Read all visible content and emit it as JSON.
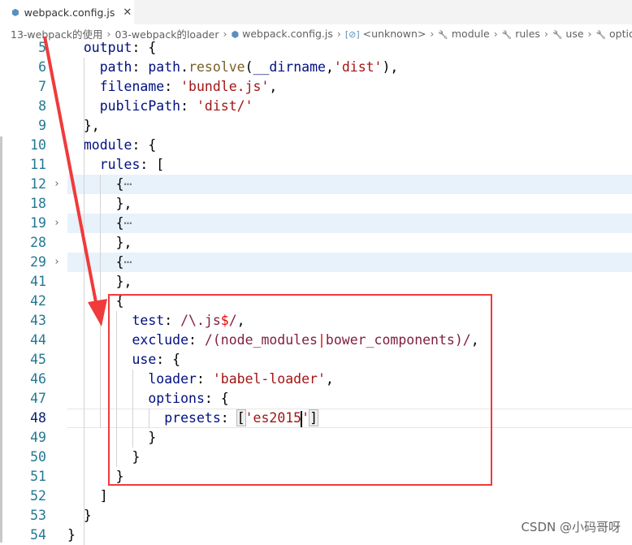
{
  "tab": {
    "title": "webpack.config.js",
    "icon": "webpack-icon",
    "close": "✕"
  },
  "breadcrumbs": [
    "13-webpack的使用",
    "03-webpack的loader",
    "webpack.config.js",
    "<unknown>",
    "module",
    "rules",
    "use",
    "options"
  ],
  "editor": {
    "current_line": 48,
    "lines": [
      {
        "n": 5,
        "t": [
          [
            "  ",
            ""
          ],
          [
            "output",
            "k"
          ],
          [
            ": {",
            "p"
          ]
        ]
      },
      {
        "n": 6,
        "t": [
          [
            "    ",
            ""
          ],
          [
            "path",
            "k"
          ],
          [
            ": ",
            "p"
          ],
          [
            "path",
            "k"
          ],
          [
            ".",
            "p"
          ],
          [
            "resolve",
            "f"
          ],
          [
            "(",
            "p"
          ],
          [
            "__dirname",
            "k"
          ],
          [
            ",",
            "p"
          ],
          [
            "'dist'",
            "s"
          ],
          [
            "),",
            "p"
          ]
        ]
      },
      {
        "n": 7,
        "t": [
          [
            "    ",
            ""
          ],
          [
            "filename",
            "k"
          ],
          [
            ": ",
            "p"
          ],
          [
            "'bundle.js'",
            "s"
          ],
          [
            ",",
            "p"
          ]
        ]
      },
      {
        "n": 8,
        "t": [
          [
            "    ",
            ""
          ],
          [
            "publicPath",
            "k"
          ],
          [
            ": ",
            "p"
          ],
          [
            "'dist/'",
            "s"
          ]
        ]
      },
      {
        "n": 9,
        "t": [
          [
            "  },",
            "p"
          ]
        ]
      },
      {
        "n": 10,
        "t": [
          [
            "  ",
            ""
          ],
          [
            "module",
            "k"
          ],
          [
            ": {",
            "p"
          ]
        ]
      },
      {
        "n": 11,
        "t": [
          [
            "    ",
            ""
          ],
          [
            "rules",
            "k"
          ],
          [
            ": [",
            "p"
          ]
        ]
      },
      {
        "n": 12,
        "t": [
          [
            "      {",
            "p"
          ],
          [
            "⋯",
            "c"
          ]
        ],
        "folded": true
      },
      {
        "n": 18,
        "t": [
          [
            "      },",
            "p"
          ]
        ]
      },
      {
        "n": 19,
        "t": [
          [
            "      {",
            "p"
          ],
          [
            "⋯",
            "c"
          ]
        ],
        "folded": true
      },
      {
        "n": 28,
        "t": [
          [
            "      },",
            "p"
          ]
        ]
      },
      {
        "n": 29,
        "t": [
          [
            "      {",
            "p"
          ],
          [
            "⋯",
            "c"
          ]
        ],
        "folded": true
      },
      {
        "n": 41,
        "t": [
          [
            "      },",
            "p"
          ]
        ]
      },
      {
        "n": 42,
        "t": [
          [
            "      {",
            "p"
          ]
        ]
      },
      {
        "n": 43,
        "t": [
          [
            "        ",
            ""
          ],
          [
            "test",
            "k"
          ],
          [
            ": ",
            "p"
          ],
          [
            "/\\.js",
            "r"
          ],
          [
            "$",
            "rr"
          ],
          [
            "/",
            "r"
          ],
          [
            ",",
            "p"
          ]
        ]
      },
      {
        "n": 44,
        "t": [
          [
            "        ",
            ""
          ],
          [
            "exclude",
            "k"
          ],
          [
            ": ",
            "p"
          ],
          [
            "/(node_modules",
            "r"
          ],
          [
            "|",
            "rr"
          ],
          [
            "bower_components)/",
            "r"
          ],
          [
            ",",
            "p"
          ]
        ]
      },
      {
        "n": 45,
        "t": [
          [
            "        ",
            ""
          ],
          [
            "use",
            "k"
          ],
          [
            ": {",
            "p"
          ]
        ]
      },
      {
        "n": 46,
        "t": [
          [
            "          ",
            ""
          ],
          [
            "loader",
            "k"
          ],
          [
            ": ",
            "p"
          ],
          [
            "'babel-loader'",
            "s"
          ],
          [
            ",",
            "p"
          ]
        ]
      },
      {
        "n": 47,
        "t": [
          [
            "          ",
            ""
          ],
          [
            "options",
            "k"
          ],
          [
            ": {",
            "p"
          ]
        ]
      },
      {
        "n": 48,
        "t": [
          [
            "            ",
            ""
          ],
          [
            "presets",
            "k"
          ],
          [
            ": ",
            "p"
          ],
          [
            "[",
            "bm"
          ],
          [
            "'es2015'",
            "s"
          ],
          [
            "]",
            "bm"
          ]
        ]
      },
      {
        "n": 49,
        "t": [
          [
            "          }",
            "p"
          ]
        ]
      },
      {
        "n": 50,
        "t": [
          [
            "        }",
            "p"
          ]
        ]
      },
      {
        "n": 51,
        "t": [
          [
            "      }",
            "p"
          ]
        ]
      },
      {
        "n": 52,
        "t": [
          [
            "    ]",
            "p"
          ]
        ]
      },
      {
        "n": 53,
        "t": [
          [
            "  }",
            "p"
          ]
        ]
      },
      {
        "n": 54,
        "t": [
          [
            "}",
            "p"
          ]
        ]
      }
    ]
  },
  "colors": {
    "annotation": "#ef3b3b"
  },
  "watermark": "CSDN @小码哥呀"
}
